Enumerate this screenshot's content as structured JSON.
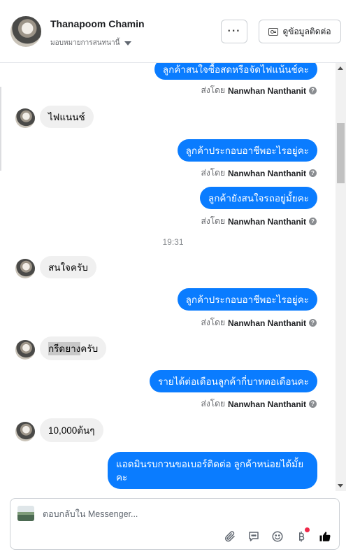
{
  "header": {
    "contact_name": "Thanapoom Chamin",
    "assign_label": "มอบหมายการสนทนานี้",
    "more_label": "···",
    "contact_info_label": "ดูข้อมูลติดต่อ"
  },
  "messages": {
    "out1": "ลูกค้าสนใจซื้อสดหรือจัดไฟแน้นช์คะ",
    "sender_prefix": "ส่งโดย",
    "sender_name": "Nanwhan Nanthanit",
    "in1": "ไฟแนนช์",
    "out2": "ลูกค้าประกอบอาชีพอะไรอยู่คะ",
    "out3": "ลูกค้ายังสนใจรถอยู่มั้ยคะ",
    "time1": "19:31",
    "in2": "สนใจครับ",
    "out4": "ลูกค้าประกอบอาชีพอะไรอยู่คะ",
    "in3_highlight": "กรีดยาง",
    "in3_rest": "ครับ",
    "out5": "รายได้ต่อเดือนลูกค้ากี่บาทตอเดือนคะ",
    "in4": "10,000ต้นๆ",
    "out6": "แอดมินรบกวนขอเบอร์ติดต่อ ลูกค้าหน่อยได้มั้ยคะ"
  },
  "composer": {
    "placeholder": "ตอบกลับใน Messenger..."
  },
  "colors": {
    "accent": "#0a7cff",
    "incoming_bubble": "#f0f0f0",
    "notification_dot": "#f02849"
  },
  "icons": {
    "attach": "paperclip-icon",
    "saved_replies": "speech-bubble-icon",
    "emoji": "smiley-icon",
    "payment": "baht-icon",
    "like": "thumbs-up-icon"
  }
}
